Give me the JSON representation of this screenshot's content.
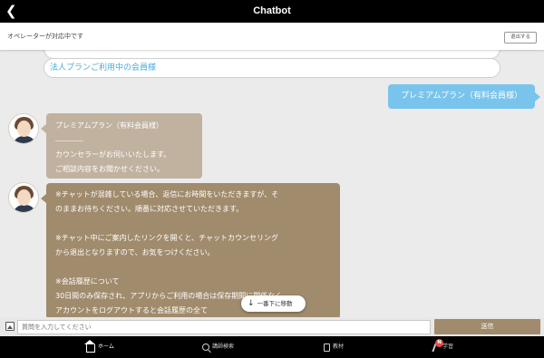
{
  "header": {
    "title": "Chatbot",
    "back_icon": "chevron-left-icon"
  },
  "operator_bar": {
    "status": "オペレーターが対応中です",
    "exit_label": "退出する"
  },
  "options": {
    "corporate": "法人プランご利用中の会員様"
  },
  "user_message": "プレミアムプラン（有料会員様）",
  "bot_message_1": {
    "line1": "プレミアムプラン（有料会員様）",
    "divider": "―――――",
    "line2": "カウンセラーがお伺いいたします。",
    "line3": "ご相談内容をお聞かせください。"
  },
  "bot_message_2": {
    "p1_l1": "※チャットが混雑している場合、返信にお時間をいただきますが、そ",
    "p1_l2": "のままお待ちください。順番に対応させていただきます。",
    "p2_l1": "※チャット中にご案内したリンクを開くと、チャットカウンセリング",
    "p2_l2": "から退出となりますので、お気をつけください。",
    "p3_l1": "※会話履歴について",
    "p3_l2": "30日間のみ保存され、アプリからご利用の場合は保存期間に関係なく",
    "p3_l3": "アカウントをログアウトすると会話履歴の全て"
  },
  "scroll_button": {
    "label": "一番下に移動"
  },
  "input": {
    "placeholder": "質問を入力してください",
    "value": "",
    "send_label": "送信"
  },
  "tabs": [
    {
      "label": "ホーム",
      "icon": "home-icon"
    },
    {
      "label": "講師検索",
      "icon": "search-icon"
    },
    {
      "label": "教材",
      "icon": "book-icon"
    },
    {
      "label": "学習",
      "icon": "pen-icon"
    }
  ],
  "badge": "N",
  "colors": {
    "user_bubble": "#78c4ec",
    "bot_bubble_light": "#c0b29f",
    "bot_bubble_dark": "#a08b6c",
    "link": "#4aa9dc",
    "badge": "#e84a3e"
  }
}
